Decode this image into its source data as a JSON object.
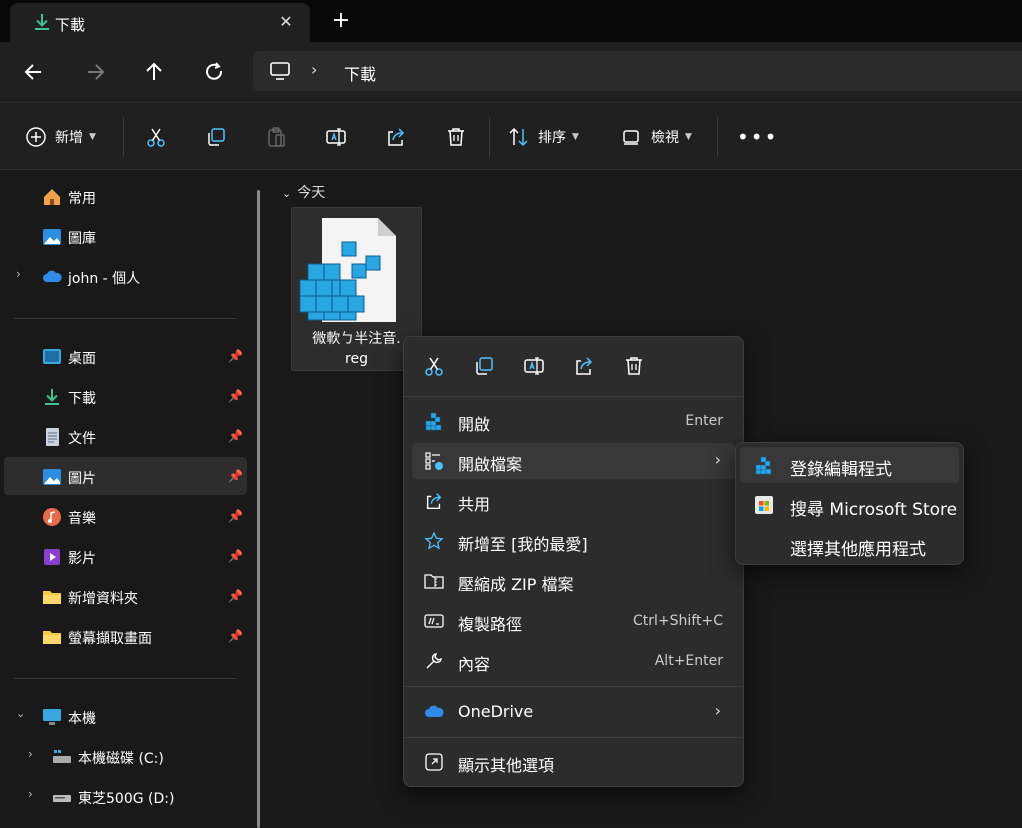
{
  "tab": {
    "title": "下載"
  },
  "address": {
    "breadcrumb": "下載"
  },
  "toolbar": {
    "new_label": "新增",
    "sort_label": "排序",
    "view_label": "檢視"
  },
  "sidebar": {
    "top_items": [
      {
        "label": "常用"
      },
      {
        "label": "圖庫"
      },
      {
        "label": "john - 個人"
      }
    ],
    "pinned_items": [
      {
        "label": "桌面"
      },
      {
        "label": "下載"
      },
      {
        "label": "文件"
      },
      {
        "label": "圖片"
      },
      {
        "label": "音樂"
      },
      {
        "label": "影片"
      },
      {
        "label": "新增資料夾"
      },
      {
        "label": "螢幕擷取畫面"
      }
    ],
    "this_pc": {
      "label": "本機"
    },
    "drives": [
      {
        "label": "本機磁碟 (C:)"
      },
      {
        "label": "東芝500G (D:)"
      }
    ]
  },
  "content": {
    "group_header": "今天",
    "file": {
      "name_line1": "微軟ㄅ半注音.",
      "name_line2": "reg"
    }
  },
  "context_menu": {
    "items": [
      {
        "label": "開啟",
        "shortcut": "Enter"
      },
      {
        "label": "開啟檔案"
      },
      {
        "label": "共用"
      },
      {
        "label": "新增至 [我的最愛]"
      },
      {
        "label": "壓縮成 ZIP 檔案"
      },
      {
        "label": "複製路徑",
        "shortcut": "Ctrl+Shift+C"
      },
      {
        "label": "內容",
        "shortcut": "Alt+Enter"
      },
      {
        "label": "OneDrive"
      },
      {
        "label": "顯示其他選項"
      }
    ]
  },
  "submenu": {
    "items": [
      {
        "label": "登錄編輯程式"
      },
      {
        "label": "搜尋 Microsoft Store"
      },
      {
        "label": "選擇其他應用程式"
      }
    ]
  },
  "colors": {
    "accent": "#4cc2ff",
    "download_green": "#3ec28f",
    "folder_yellow": "#f8c94a"
  }
}
